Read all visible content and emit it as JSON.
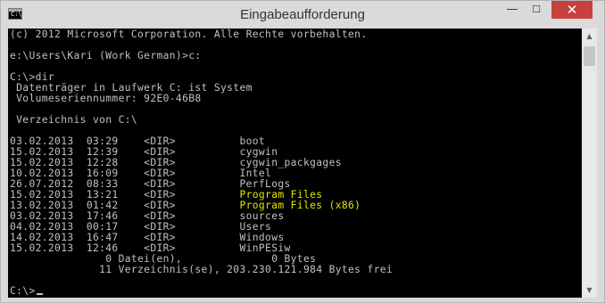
{
  "window": {
    "title": "Eingabeaufforderung",
    "icon": "cmd-icon",
    "buttons": {
      "minimize": "—",
      "maximize": "☐",
      "close": "✕"
    }
  },
  "console": {
    "text_color": "#c0c0c0",
    "highlight_color": "#e6e600",
    "lines": [
      "(c) 2012 Microsoft Corporation. Alle Rechte vorbehalten.",
      "",
      "e:\\Users\\Kari (Work German)>c:",
      "",
      "C:\\>dir",
      " Datenträger in Laufwerk C: ist System",
      " Volumeseriennummer: 92E0-46B8",
      "",
      " Verzeichnis von C:\\",
      "",
      "03.02.2013  03:29    <DIR>          boot",
      "15.02.2013  12:39    <DIR>          cygwin",
      "15.02.2013  12:28    <DIR>          cygwin_packgages",
      "10.02.2013  16:09    <DIR>          Intel",
      "26.07.2012  08:33    <DIR>          PerfLogs",
      "15.02.2013  13:21    <DIR>          Program Files",
      "13.02.2013  01:42    <DIR>          Program Files (x86)",
      "03.02.2013  17:46    <DIR>          sources",
      "04.02.2013  00:17    <DIR>          Users",
      "14.02.2013  16:47    <DIR>          Windows",
      "15.02.2013  12:46    <DIR>          WinPESiw",
      "               0 Datei(en),              0 Bytes",
      "              11 Verzeichnis(se), 203.230.121.984 Bytes frei",
      "",
      "C:\\>"
    ],
    "highlighted_lines": [
      15,
      16
    ]
  },
  "scrollbar": {
    "up": "▲",
    "down": "▼"
  }
}
